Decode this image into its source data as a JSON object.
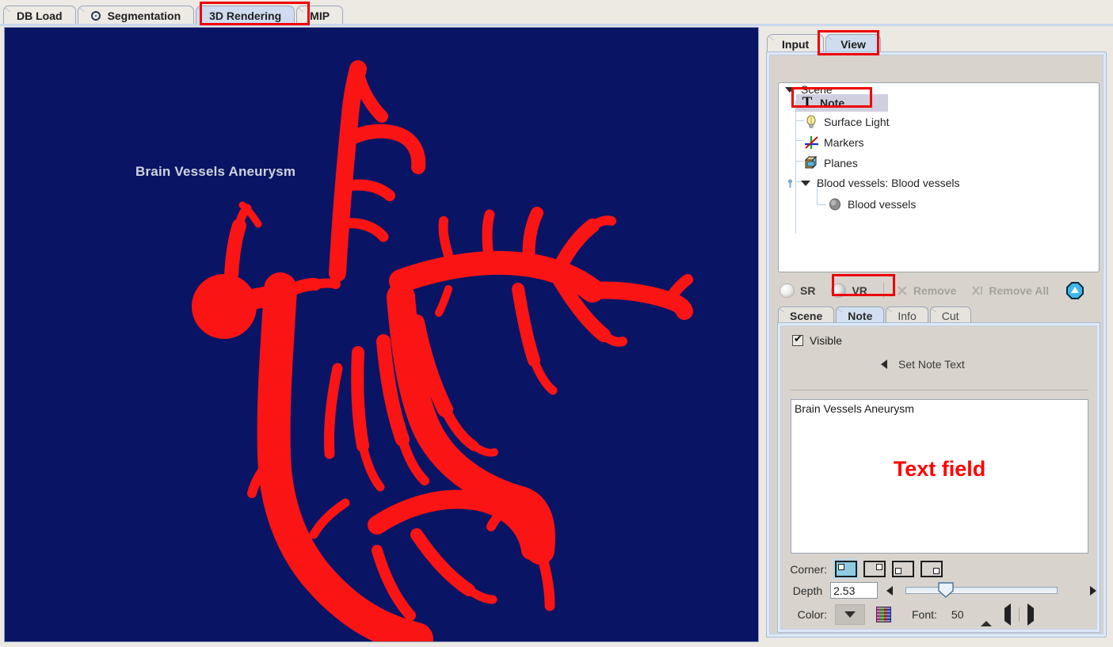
{
  "top_tabs": [
    {
      "label": "DB Load",
      "icon": null,
      "selected": false
    },
    {
      "label": "Segmentation",
      "icon": "target-icon",
      "selected": false
    },
    {
      "label": "3D Rendering",
      "icon": null,
      "selected": true
    },
    {
      "label": "MIP",
      "icon": null,
      "selected": false
    }
  ],
  "viewport": {
    "overlay_text": "Brain Vessels Aneurysm",
    "background_color": "#0a1464",
    "vessel_color": "#fb1414"
  },
  "right_panel": {
    "view_tabs": [
      {
        "label": "Input",
        "selected": false
      },
      {
        "label": "View",
        "selected": true
      }
    ],
    "tree": {
      "root": "Scene",
      "items": [
        {
          "label": "Note",
          "icon": "text-T-icon",
          "selected": true,
          "depth": 1
        },
        {
          "label": "Surface Light",
          "icon": "lightbulb-icon",
          "selected": false,
          "depth": 1
        },
        {
          "label": "Markers",
          "icon": "axes-markers-icon",
          "selected": false,
          "depth": 1
        },
        {
          "label": "Planes",
          "icon": "cube-planes-icon",
          "selected": false,
          "depth": 1
        },
        {
          "label": "Blood vessels: Blood vessels",
          "icon": "expander-icon",
          "selected": false,
          "depth": 1
        },
        {
          "label": "Blood vessels",
          "icon": "surface-blob-icon",
          "selected": false,
          "depth": 2
        }
      ]
    },
    "toolbar": {
      "sr_label": "SR",
      "vr_label": "VR",
      "remove_label": "Remove",
      "remove_all_label": "Remove All",
      "export_icon": "upload-octagon-icon"
    },
    "lower_tabs": [
      {
        "label": "Scene",
        "selected": false
      },
      {
        "label": "Note",
        "selected": true
      },
      {
        "label": "Info",
        "selected": false
      },
      {
        "label": "Cut",
        "selected": false
      }
    ],
    "note_panel": {
      "visible_label": "Visible",
      "visible_checked": true,
      "set_note_text_label": "Set Note Text",
      "note_text": "Brain Vessels Aneurysm",
      "annotation_text": "Text field",
      "annotation_color": "#ff0000",
      "corner_label": "Corner:",
      "corner_selected_index": 0,
      "depth_label": "Depth",
      "depth_value": "2.53",
      "depth_slider_percent": 22,
      "color_label": "Color:",
      "font_label": "Font:",
      "font_size": "50"
    }
  }
}
